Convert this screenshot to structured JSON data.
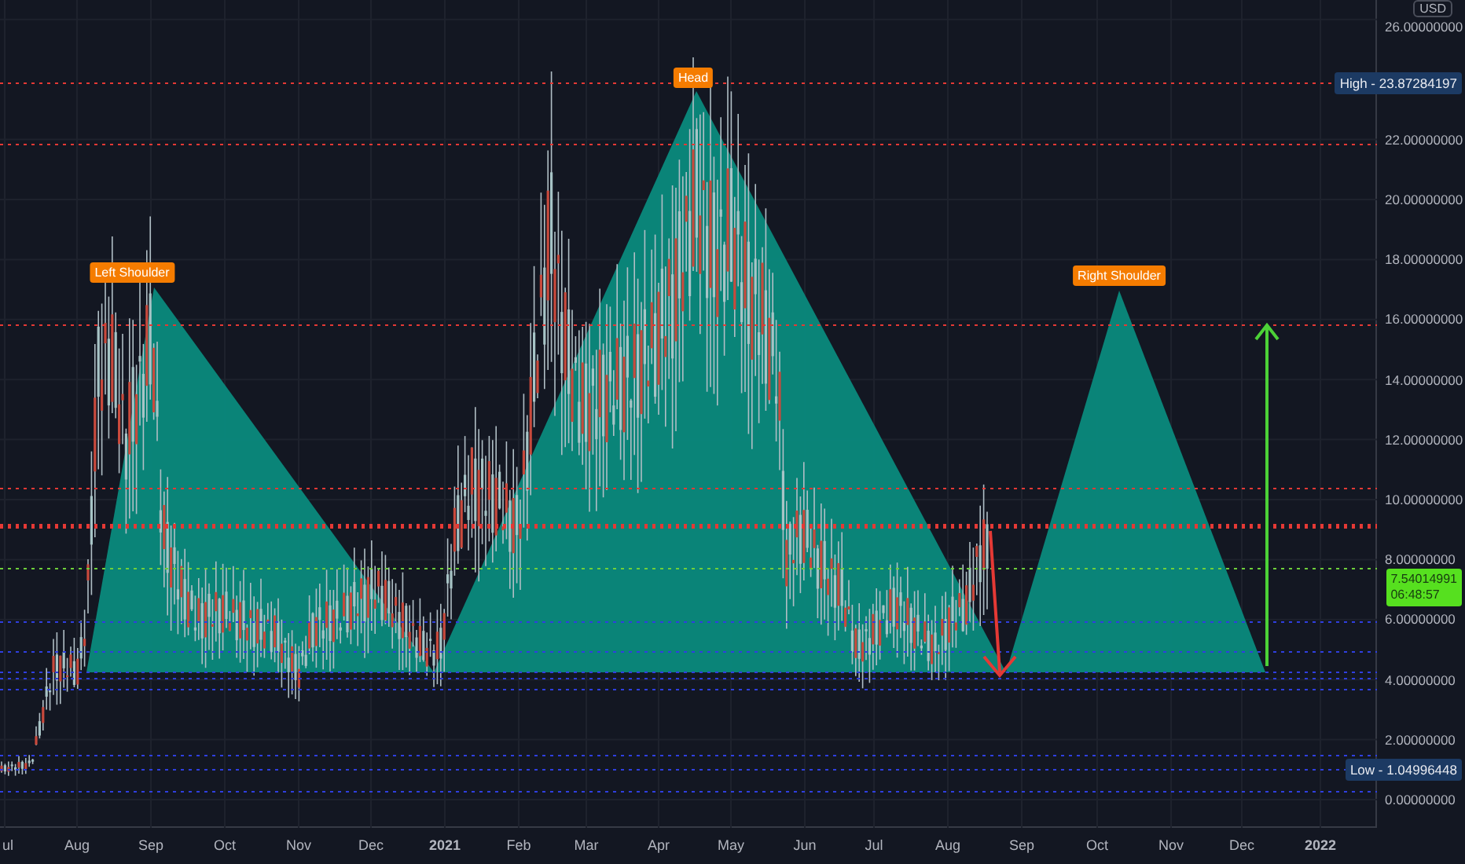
{
  "chart": {
    "pattern_labels": [
      "Left Shoulder",
      "Head",
      "Right Shoulder"
    ]
  },
  "price_axis": {
    "currency": "USD",
    "ticks": [
      "26.00000000",
      "22.00000000",
      "20.00000000",
      "18.00000000",
      "16.00000000",
      "14.00000000",
      "12.00000000",
      "10.00000000",
      "8.00000000",
      "6.00000000",
      "4.00000000",
      "2.00000000",
      "0.00000000"
    ],
    "high_badge": "High - 23.87284197",
    "low_badge": "Low - 1.04996448",
    "last_price": {
      "value": "7.54014991",
      "countdown": "06:48:57"
    }
  },
  "time_axis": {
    "ticks": [
      "ul",
      "Aug",
      "Sep",
      "Oct",
      "Nov",
      "Dec",
      "2021",
      "Feb",
      "Mar",
      "Apr",
      "May",
      "Jun",
      "Jul",
      "Aug",
      "Sep",
      "Oct",
      "Nov",
      "Dec",
      "2022"
    ]
  }
}
